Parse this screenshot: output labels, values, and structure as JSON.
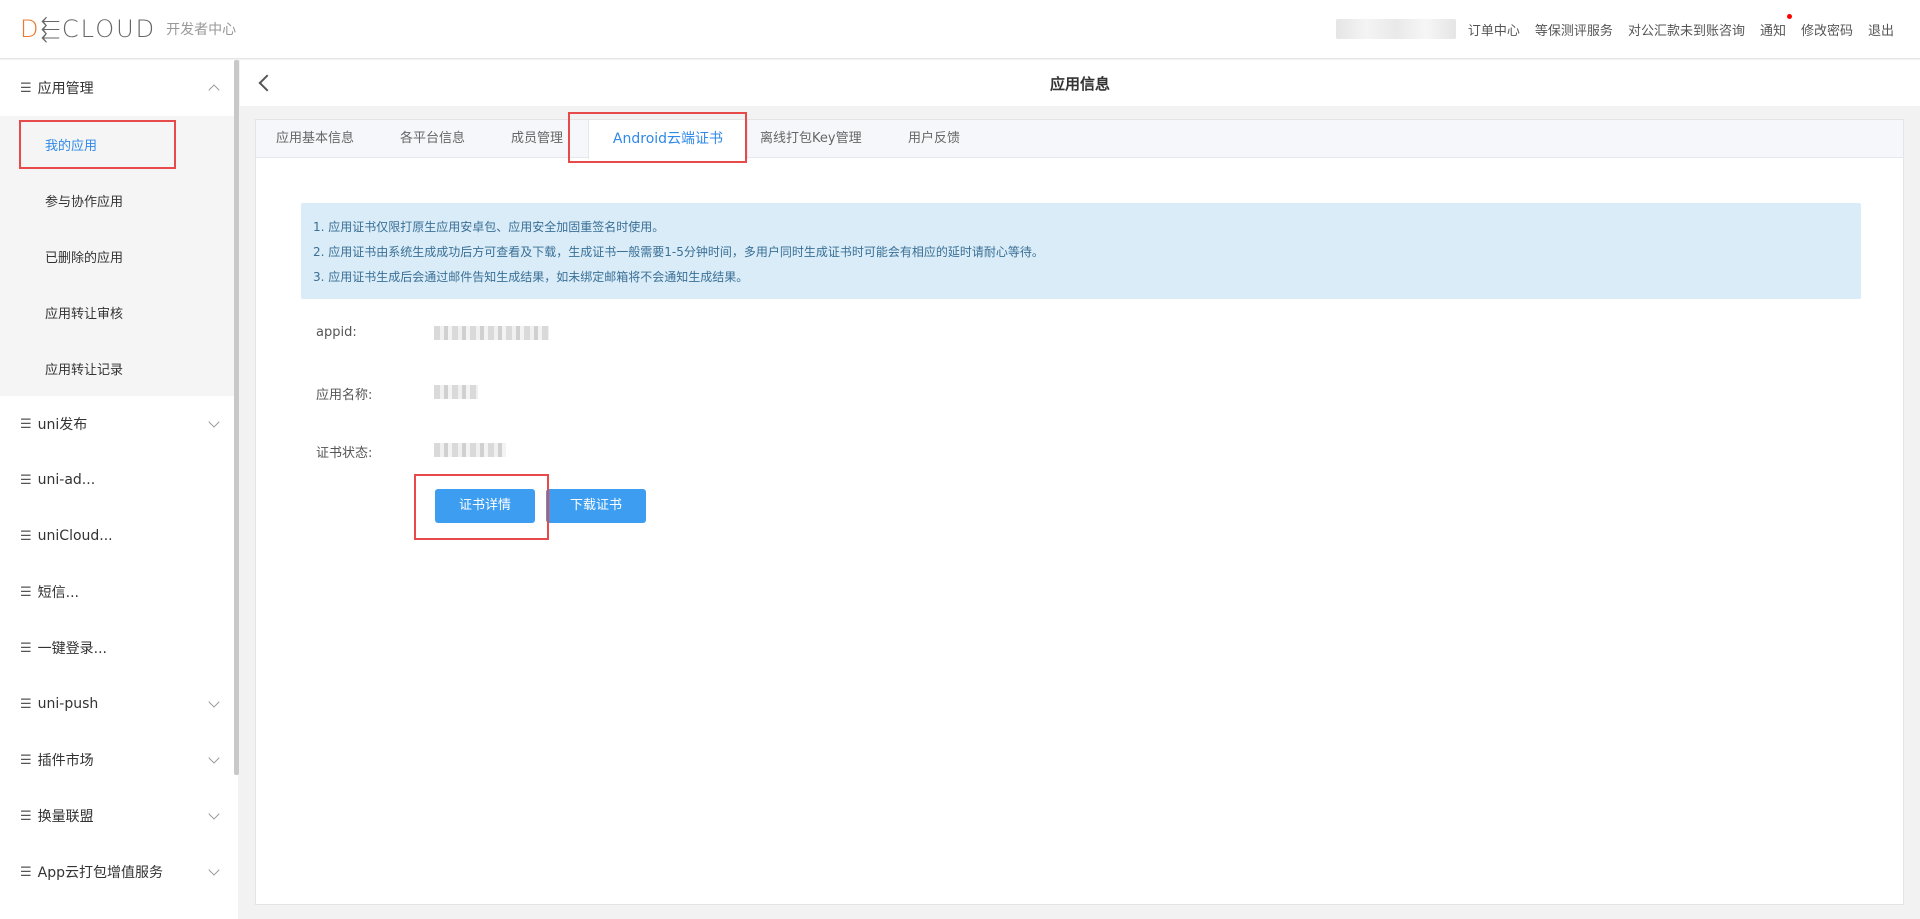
{
  "header": {
    "logo_text": "DCLOUD",
    "logo_sub": "开发者中心",
    "links": [
      "订单中心",
      "等保测评服务",
      "对公汇款未到账咨询",
      "通知",
      "修改密码",
      "退出"
    ]
  },
  "sidebar": {
    "groups": [
      {
        "label": "应用管理",
        "expanded": true
      },
      {
        "label": "uni发布"
      },
      {
        "label": "uni-ad..."
      },
      {
        "label": "uniCloud..."
      },
      {
        "label": "短信..."
      },
      {
        "label": "一键登录..."
      },
      {
        "label": "uni-push"
      },
      {
        "label": "插件市场"
      },
      {
        "label": "换量联盟"
      },
      {
        "label": "App云打包增值服务"
      }
    ],
    "sub_items": [
      "我的应用",
      "参与协作应用",
      "已删除的应用",
      "应用转让审核",
      "应用转让记录"
    ],
    "active_sub": "我的应用"
  },
  "page": {
    "title": "应用信息"
  },
  "tabs": [
    "应用基本信息",
    "各平台信息",
    "成员管理",
    "Android云端证书",
    "离线打包Key管理",
    "用户反馈"
  ],
  "active_tab": "Android云端证书",
  "notice": [
    "1. 应用证书仅限打原生应用安卓包、应用安全加固重签名时使用。",
    "2. 应用证书由系统生成成功后方可查看及下载，生成证书一般需要1-5分钟时间，多用户同时生成证书时可能会有相应的延时请耐心等待。",
    "3. 应用证书生成后会通过邮件告知生成结果，如未绑定邮箱将不会通知生成结果。"
  ],
  "fields": {
    "appid_label": "appid:",
    "name_label": "应用名称:",
    "status_label": "证书状态:"
  },
  "buttons": {
    "detail": "证书详情",
    "download": "下载证书"
  },
  "colors": {
    "accent": "#2f89e8",
    "button": "#3d9df0",
    "highlight": "#e74a4a",
    "notice_bg": "#d9ecf7"
  }
}
